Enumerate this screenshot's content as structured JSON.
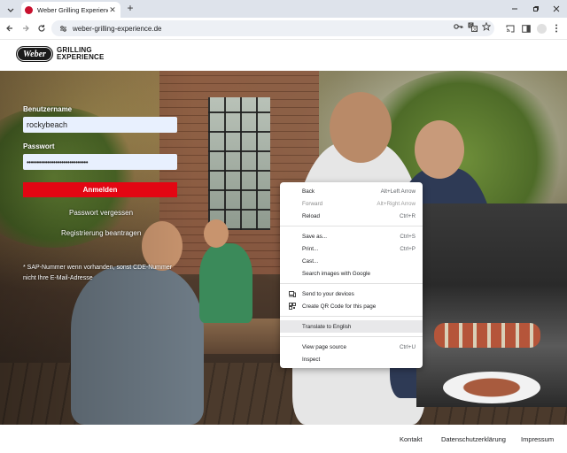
{
  "browser": {
    "tab_title": "Weber Grilling Experience",
    "tab_close": "✕",
    "new_tab": "+",
    "url": "weber-grilling-experience.de",
    "icons": [
      "tab-search-icon",
      "back-icon",
      "forward-icon",
      "reload-icon",
      "site-info-icon",
      "password-key-icon",
      "translate-icon",
      "bookmark-star-icon",
      "cast-icon",
      "side-panel-icon",
      "profile-icon",
      "menu-icon"
    ]
  },
  "logo": {
    "mark": "Weber",
    "line1": "GRILLING",
    "line2": "EXPERIENCE"
  },
  "login": {
    "username_label": "Benutzername",
    "username_value": "rockybeach",
    "password_label": "Passwort",
    "password_value": "••••••••••••••••••••••••••••••",
    "submit_label": "Anmelden",
    "forgot_password": "Passwort vergessen",
    "register": "Registrierung beantragen",
    "sap_note": "* SAP-Nummer wenn vorhanden, sonst CDE-Nummer nicht Ihre E-Mail-Adresse"
  },
  "context_menu": {
    "items": [
      {
        "label": "Back",
        "shortcut": "Alt+Left Arrow",
        "disabled": false
      },
      {
        "label": "Forward",
        "shortcut": "Alt+Right Arrow",
        "disabled": true
      },
      {
        "label": "Reload",
        "shortcut": "Ctrl+R",
        "disabled": false
      },
      {
        "label": "Save as...",
        "shortcut": "Ctrl+S",
        "disabled": false
      },
      {
        "label": "Print...",
        "shortcut": "Ctrl+P",
        "disabled": false
      },
      {
        "label": "Cast...",
        "shortcut": "",
        "disabled": false
      },
      {
        "label": "Search images with Google",
        "shortcut": "",
        "disabled": false
      },
      {
        "label": "Send to your devices",
        "shortcut": "",
        "icon": "devices-icon"
      },
      {
        "label": "Create QR Code for this page",
        "shortcut": "",
        "icon": "qr-code-icon"
      },
      {
        "label": "Translate to English",
        "shortcut": "",
        "highlighted": true
      },
      {
        "label": "View page source",
        "shortcut": "Ctrl+U",
        "disabled": false
      },
      {
        "label": "Inspect",
        "shortcut": "",
        "disabled": false
      }
    ]
  },
  "footer": {
    "kontakt": "Kontakt",
    "datenschutz": "Datenschutzerklärung",
    "impressum": "Impressum"
  },
  "colors": {
    "brand_red": "#e30613",
    "tabstrip": "#dee3eb",
    "omnibox": "#edf0f5",
    "input_fill": "#e8f0fe"
  }
}
